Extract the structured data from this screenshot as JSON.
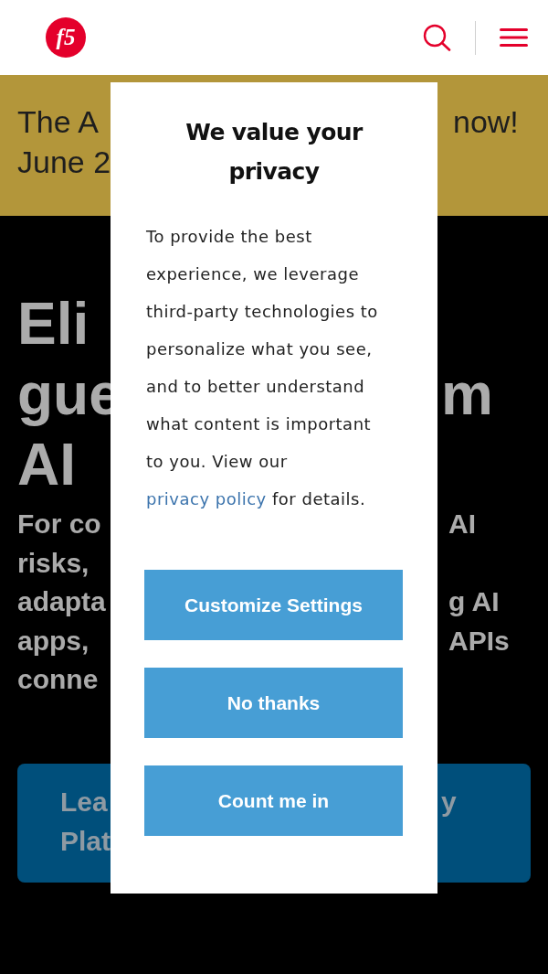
{
  "header": {
    "logo_text": "f5"
  },
  "banner": {
    "lines": [
      {
        "left": "The A",
        "right": "now!"
      },
      {
        "left": "June 2"
      }
    ]
  },
  "hero": {
    "heading_lines": [
      {
        "left": "Eli"
      },
      {
        "left": "gue",
        "right": "m"
      },
      {
        "left": "AI"
      }
    ],
    "subtitle_lines": [
      {
        "left": "For co",
        "right": "AI"
      },
      {
        "left": "risks,"
      },
      {
        "left": "adapta",
        "right": "g AI"
      },
      {
        "left": "apps,",
        "right": "APIs"
      },
      {
        "left": "conne"
      }
    ],
    "cta_lines": [
      {
        "left": "Lea",
        "right": "y"
      },
      {
        "left": "Plat"
      }
    ]
  },
  "privacy_dialog": {
    "title": "We value your privacy",
    "body_before_link": "To provide the best experience, we leverage third-party technologies to personalize what you see, and to better understand what content is important to you. View our",
    "link": "privacy policy",
    "body_after_link": "for details.",
    "buttons": [
      "Customize Settings",
      "No thanks",
      "Count me in"
    ]
  }
}
